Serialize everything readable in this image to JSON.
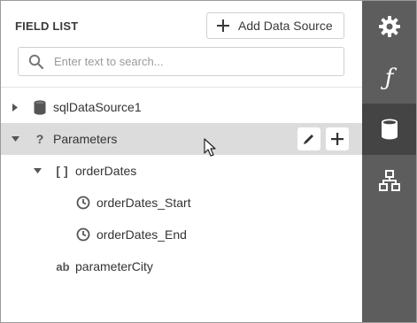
{
  "panel": {
    "title": "FIELD LIST",
    "add_data_source_label": "Add Data Source",
    "search_placeholder": "Enter text to search..."
  },
  "tree": {
    "items": [
      {
        "label": "sqlDataSource1",
        "icon": "database-icon",
        "expander": "collapsed"
      },
      {
        "label": "Parameters",
        "icon": "question-icon",
        "icon_text": "?",
        "expander": "expanded",
        "selected": true
      },
      {
        "label": "orderDates",
        "icon": "brackets-icon",
        "icon_text": "[ ]",
        "expander": "expanded"
      },
      {
        "label": "orderDates_Start",
        "icon": "clock-icon"
      },
      {
        "label": "orderDates_End",
        "icon": "clock-icon"
      },
      {
        "label": "parameterCity",
        "icon": "string-icon",
        "icon_text": "ab"
      }
    ],
    "selected_row_actions": [
      "edit-icon",
      "add-icon"
    ]
  },
  "rail": {
    "items": [
      {
        "icon": "gear-icon",
        "active": false
      },
      {
        "icon": "function-icon",
        "icon_text": "ƒ",
        "active": false
      },
      {
        "icon": "database-icon",
        "active": true
      },
      {
        "icon": "hierarchy-icon",
        "active": false
      }
    ]
  },
  "colors": {
    "rail_background": "#5d5d5d",
    "rail_active": "#444444",
    "selected_row": "#dcdcdc",
    "text": "#333333"
  }
}
